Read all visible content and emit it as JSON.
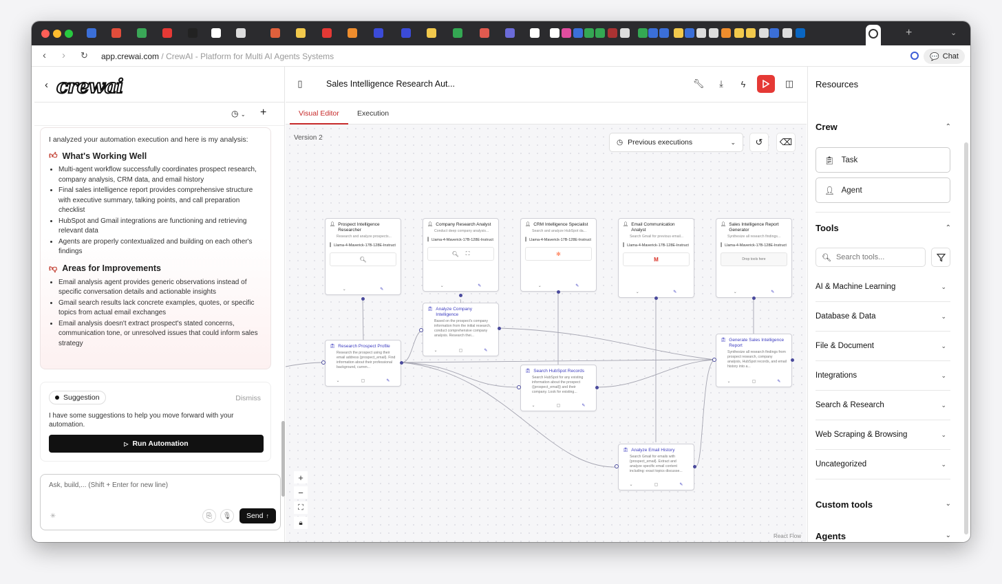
{
  "browser": {
    "url_domain": "app.crewai.com",
    "url_sep": " / ",
    "page_title": "CrewAI - Platform for Multi AI Agents Systems",
    "chat_label": "Chat"
  },
  "left": {
    "logo_text": "crewai",
    "analysis": {
      "intro": "I analyzed your automation execution and here is my analysis:",
      "working_title": "What's Working Well",
      "working_items": [
        "Multi-agent workflow successfully coordinates prospect research, company analysis, CRM data, and email history",
        "Final sales intelligence report provides comprehensive structure with executive summary, talking points, and call preparation checklist",
        "HubSpot and Gmail integrations are functioning and retrieving relevant data",
        "Agents are properly contextualized and building on each other's findings"
      ],
      "improve_title": "Areas for Improvements",
      "improve_items": [
        "Email analysis agent provides generic observations instead of specific conversation details and actionable insights",
        "Gmail search results lack concrete examples, quotes, or specific topics from actual email exchanges",
        "Email analysis doesn't extract prospect's stated concerns, communication tone, or unresolved issues that could inform sales strategy"
      ]
    },
    "suggestion": {
      "label": "Suggestion",
      "dismiss": "Dismiss",
      "text": "I have some suggestions to help you move forward with your automation.",
      "run_label": "Run Automation"
    },
    "composer": {
      "placeholder": "Ask, build,... (Shift + Enter for new line)",
      "send_label": "Send"
    }
  },
  "main": {
    "title": "Sales Intelligence Research Aut...",
    "tabs": [
      "Visual Editor",
      "Execution"
    ],
    "version": "Version 2",
    "prev_executions": "Previous executions",
    "footer": "React Flow",
    "model": "Llama-4-Maverick-17B-128E-Instruct",
    "agents": [
      {
        "name": "Prospect Intelligence Researcher",
        "desc": "Research and analyze prospects...",
        "tools": "search"
      },
      {
        "name": "Company Research Analyst",
        "desc": "Conduct deep company analysis...",
        "tools": "search-scrape"
      },
      {
        "name": "CRM Intelligence Specialist",
        "desc": "Search and analyze HubSpot da...",
        "tools": "hubspot"
      },
      {
        "name": "Email Communication Analyst",
        "desc": "Search Gmail for previous email...",
        "tools": "gmail"
      },
      {
        "name": "Sales Intelligence Report Generator",
        "desc": "Synthesize all research findings...",
        "tools": "drop",
        "drop_text": "Drop tools here"
      }
    ],
    "tasks": [
      {
        "name": "Research Prospect Profile",
        "desc": "Research the prospect using their email address {prospect_email}. Find information about their professional background, curren..."
      },
      {
        "name": "Analyze Company Intelligence",
        "desc": "Based on the prospect's company information from the initial research, conduct comprehensive company analysis. Research thei..."
      },
      {
        "name": "Search HubSpot Records",
        "desc": "Search HubSpot for any existing information about the prospect ({prospect_email}) and their company. Look for existing..."
      },
      {
        "name": "Analyze Email History",
        "desc": "Search Gmail for emails with {prospect_email}. Extract and analyze specific email content including: exact topics discusse..."
      },
      {
        "name": "Generate Sales Intelligence Report",
        "desc": "Synthesize all research findings from prospect research, company analysis, HubSpot records, and email history into a..."
      }
    ]
  },
  "right": {
    "title": "Resources",
    "crew_title": "Crew",
    "task_label": "Task",
    "agent_label": "Agent",
    "tools_title": "Tools",
    "search_placeholder": "Search tools...",
    "categories": [
      "AI & Machine Learning",
      "Database & Data",
      "File & Document",
      "Integrations",
      "Search & Research",
      "Web Scraping & Browsing",
      "Uncategorized"
    ],
    "custom_tools": "Custom tools",
    "agents_title": "Agents"
  },
  "colors": {
    "accent_red": "#e53935",
    "node_accent": "#3c3cc0",
    "edge": "#9a9aa8"
  }
}
